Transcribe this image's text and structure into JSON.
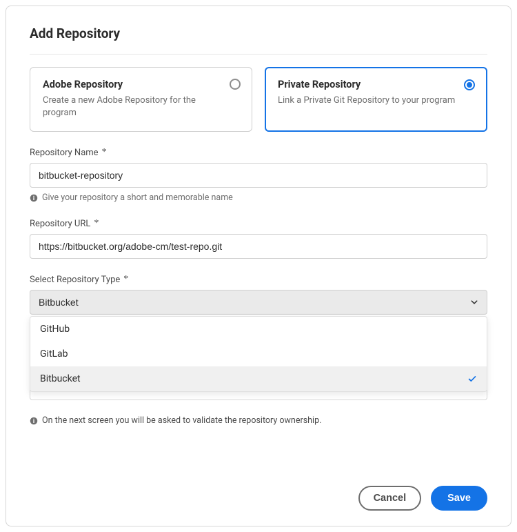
{
  "title": "Add Repository",
  "repo_type_cards": {
    "adobe": {
      "title": "Adobe Repository",
      "desc": "Create a new Adobe Repository for the program",
      "selected": false
    },
    "private": {
      "title": "Private Repository",
      "desc": "Link a Private Git Repository to your program",
      "selected": true
    }
  },
  "fields": {
    "name": {
      "label": "Repository Name",
      "value": "bitbucket-repository",
      "help": "Give your repository a short and memorable name"
    },
    "url": {
      "label": "Repository URL",
      "value": "https://bitbucket.org/adobe-cm/test-repo.git"
    },
    "type": {
      "label": "Select Repository Type",
      "selected": "Bitbucket",
      "options": [
        "GitHub",
        "GitLab",
        "Bitbucket"
      ]
    }
  },
  "footer_note": "On the next screen you will be asked to validate the repository ownership.",
  "buttons": {
    "cancel": "Cancel",
    "save": "Save"
  },
  "required_marker": "*"
}
